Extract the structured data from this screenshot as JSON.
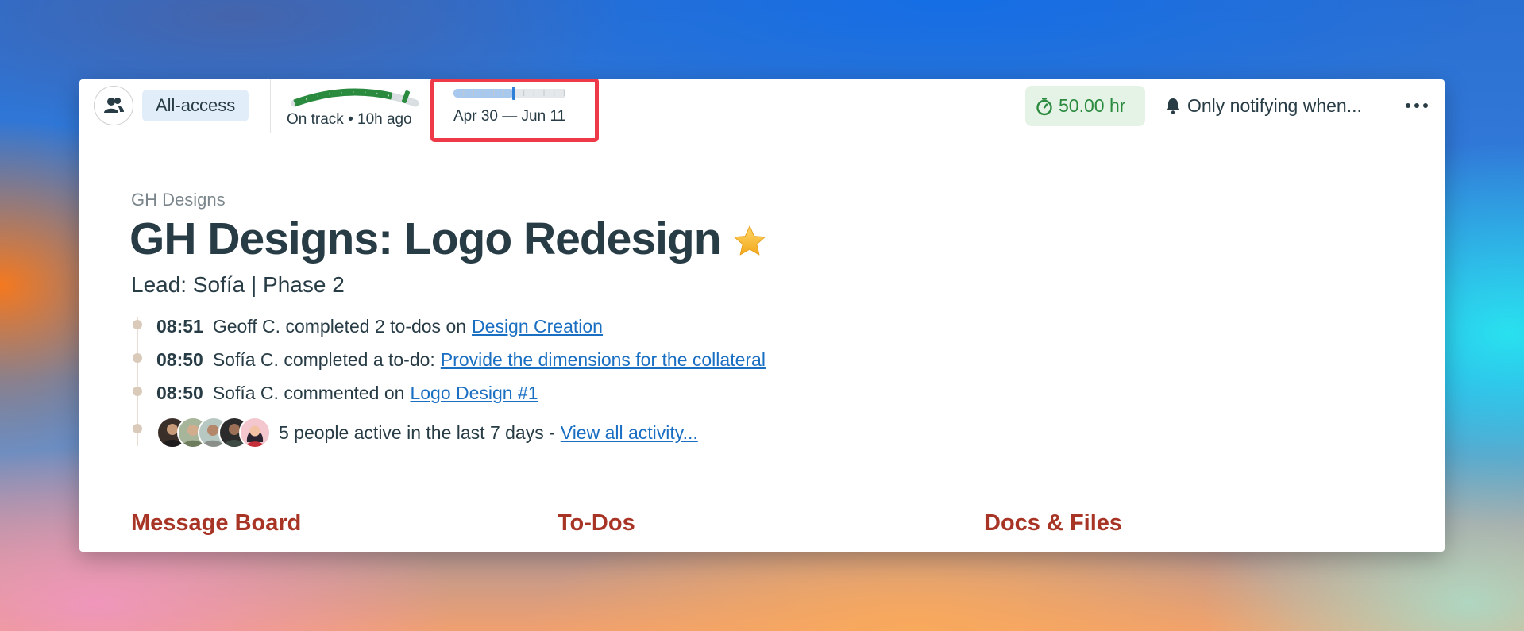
{
  "topbar": {
    "access_label": "All-access",
    "status_label": "On track • 10h ago",
    "dates_label": "Apr 30 — Jun 11",
    "hours_label": "50.00 hr",
    "notify_label": "Only notifying when...",
    "more_icon": "ellipsis-icon",
    "people_icon": "people-icon",
    "timer_icon": "stopwatch-icon",
    "bell_icon": "bell-icon",
    "progress_fraction": 0.8,
    "schedule_ticks_total": 12,
    "schedule_current_tick": 6,
    "colors": {
      "access_bg": "#e1eef9",
      "track_green": "#2a8a3e",
      "hours_bg": "#e5f3e6",
      "highlight": "#ee3a48",
      "schedule_fill": "#a9c8ee",
      "schedule_marker": "#2f7fd8"
    }
  },
  "project": {
    "breadcrumb": "GH Designs",
    "title": "GH Designs: Logo Redesign",
    "star_icon": "star-icon",
    "subtitle": "Lead: Sofía | Phase 2"
  },
  "activity": [
    {
      "time": "08:51",
      "text": "Geoff C. completed 2 to-dos on",
      "link": "Design Creation"
    },
    {
      "time": "08:50",
      "text": "Sofía C. completed a to-do:",
      "link": "Provide the dimensions for the collateral"
    },
    {
      "time": "08:50",
      "text": "Sofía C. commented on",
      "link": "Logo Design #1"
    }
  ],
  "active_people": {
    "count_text": "5 people active in the last 7 days -",
    "link": "View all activity..."
  },
  "sections": [
    "Message Board",
    "To-Dos",
    "Docs & Files"
  ],
  "colors": {
    "link": "#1a6fc2",
    "section_heading": "#a73425",
    "text": "#283c46"
  }
}
